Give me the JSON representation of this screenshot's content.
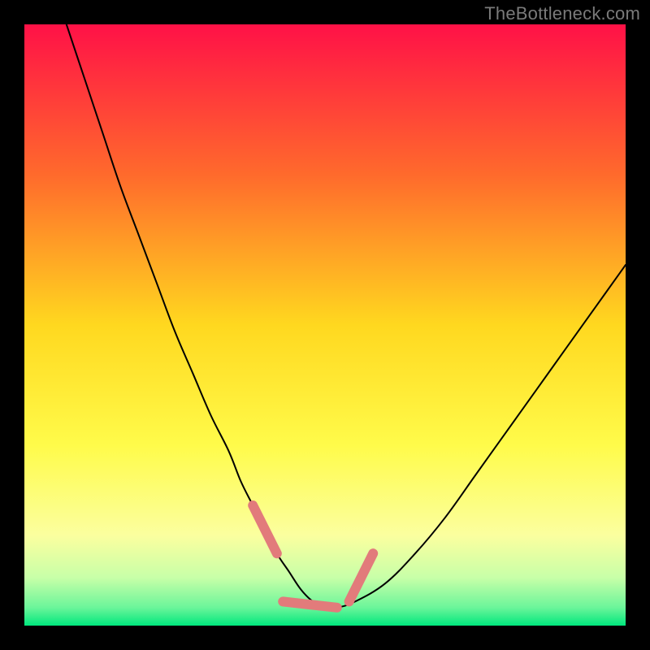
{
  "watermark": "TheBottleneck.com",
  "chart_data": {
    "type": "line",
    "title": "",
    "xlabel": "",
    "ylabel": "",
    "xlim": [
      0,
      100
    ],
    "ylim": [
      0,
      100
    ],
    "grid": false,
    "legend": false,
    "background_gradient": {
      "stops": [
        {
          "offset": 0.0,
          "color": "#ff1147"
        },
        {
          "offset": 0.25,
          "color": "#ff6a2c"
        },
        {
          "offset": 0.5,
          "color": "#ffd81f"
        },
        {
          "offset": 0.7,
          "color": "#fffb4a"
        },
        {
          "offset": 0.85,
          "color": "#fbff9f"
        },
        {
          "offset": 0.92,
          "color": "#c8ffa8"
        },
        {
          "offset": 0.97,
          "color": "#6bf59a"
        },
        {
          "offset": 1.0,
          "color": "#00e77d"
        }
      ]
    },
    "series": [
      {
        "name": "bottleneck-curve",
        "stroke": "#000000",
        "stroke_width": 2,
        "x": [
          7,
          10,
          13,
          16,
          19,
          22,
          25,
          28,
          31,
          34,
          36,
          38,
          40,
          42,
          44,
          46,
          48,
          50,
          52,
          55,
          60,
          65,
          70,
          75,
          80,
          85,
          90,
          95,
          100
        ],
        "y": [
          100,
          91,
          82,
          73,
          65,
          57,
          49,
          42,
          35,
          29,
          24,
          20,
          16,
          12,
          9,
          6,
          4,
          3,
          3,
          4,
          7,
          12,
          18,
          25,
          32,
          39,
          46,
          53,
          60
        ]
      },
      {
        "name": "bottom-highlight",
        "stroke": "#e27b7b",
        "stroke_width": 12,
        "linecap": "round",
        "segments": [
          {
            "x": [
              38,
              42
            ],
            "y": [
              20,
              12
            ]
          },
          {
            "x": [
              43,
              52
            ],
            "y": [
              4,
              3
            ]
          },
          {
            "x": [
              54,
              58
            ],
            "y": [
              4,
              12
            ]
          }
        ]
      }
    ]
  }
}
